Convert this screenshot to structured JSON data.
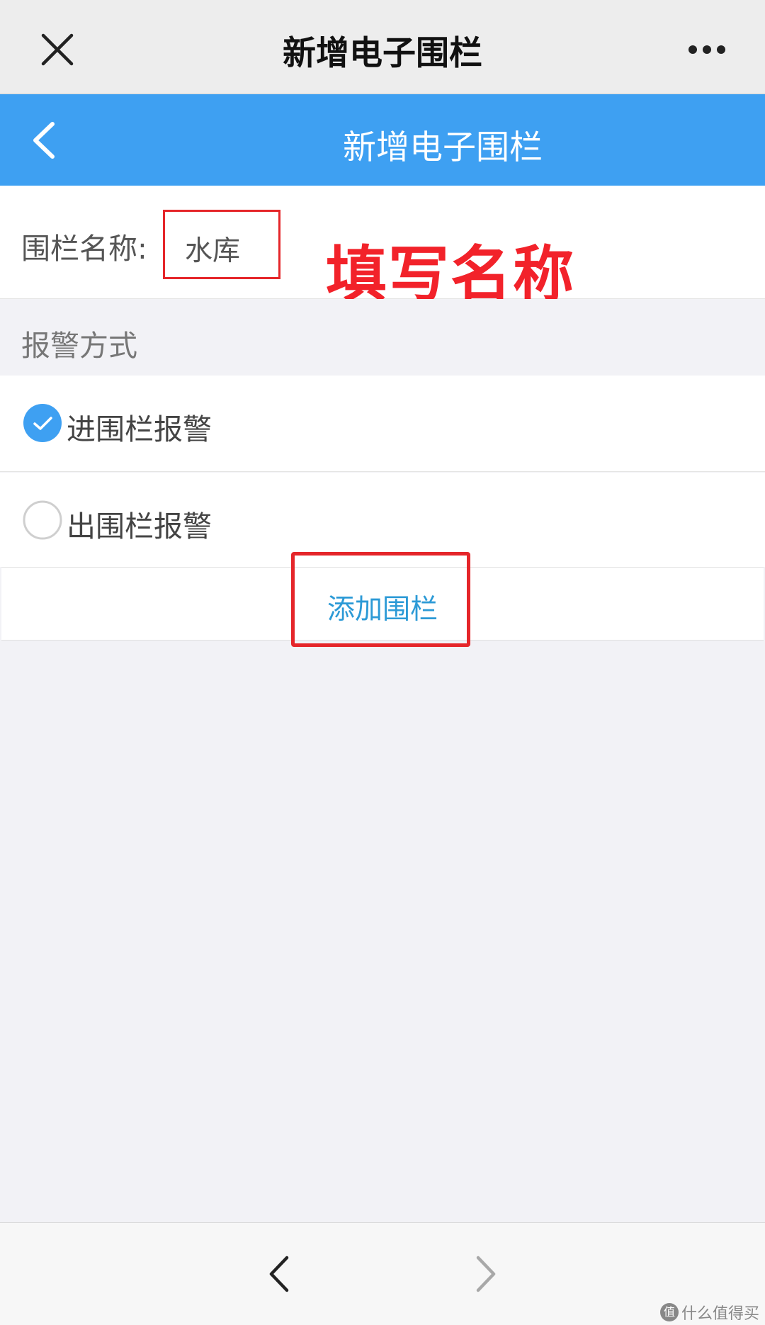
{
  "wechat_nav": {
    "title": "新增电子围栏",
    "close_icon": "close-icon",
    "more_icon": "more-icon"
  },
  "app_header": {
    "title": "新增电子围栏",
    "back_icon": "back-arrow-icon",
    "color": "#3ea0f2"
  },
  "fence_name": {
    "label": "围栏名称:",
    "value": "水库"
  },
  "annotations": {
    "fill_name": "填写名称",
    "color": "#f2222a"
  },
  "alarm_section": {
    "header": "报警方式",
    "options": [
      {
        "label": "进围栏报警",
        "checked": true
      },
      {
        "label": "出围栏报警",
        "checked": false
      }
    ]
  },
  "add_button": {
    "label": "添加围栏",
    "color": "#2c9ad6"
  },
  "browser_nav": {
    "prev_icon": "chevron-left-icon",
    "next_icon": "chevron-right-icon"
  },
  "watermark": {
    "logo_text": "值",
    "text": "什么值得买"
  }
}
